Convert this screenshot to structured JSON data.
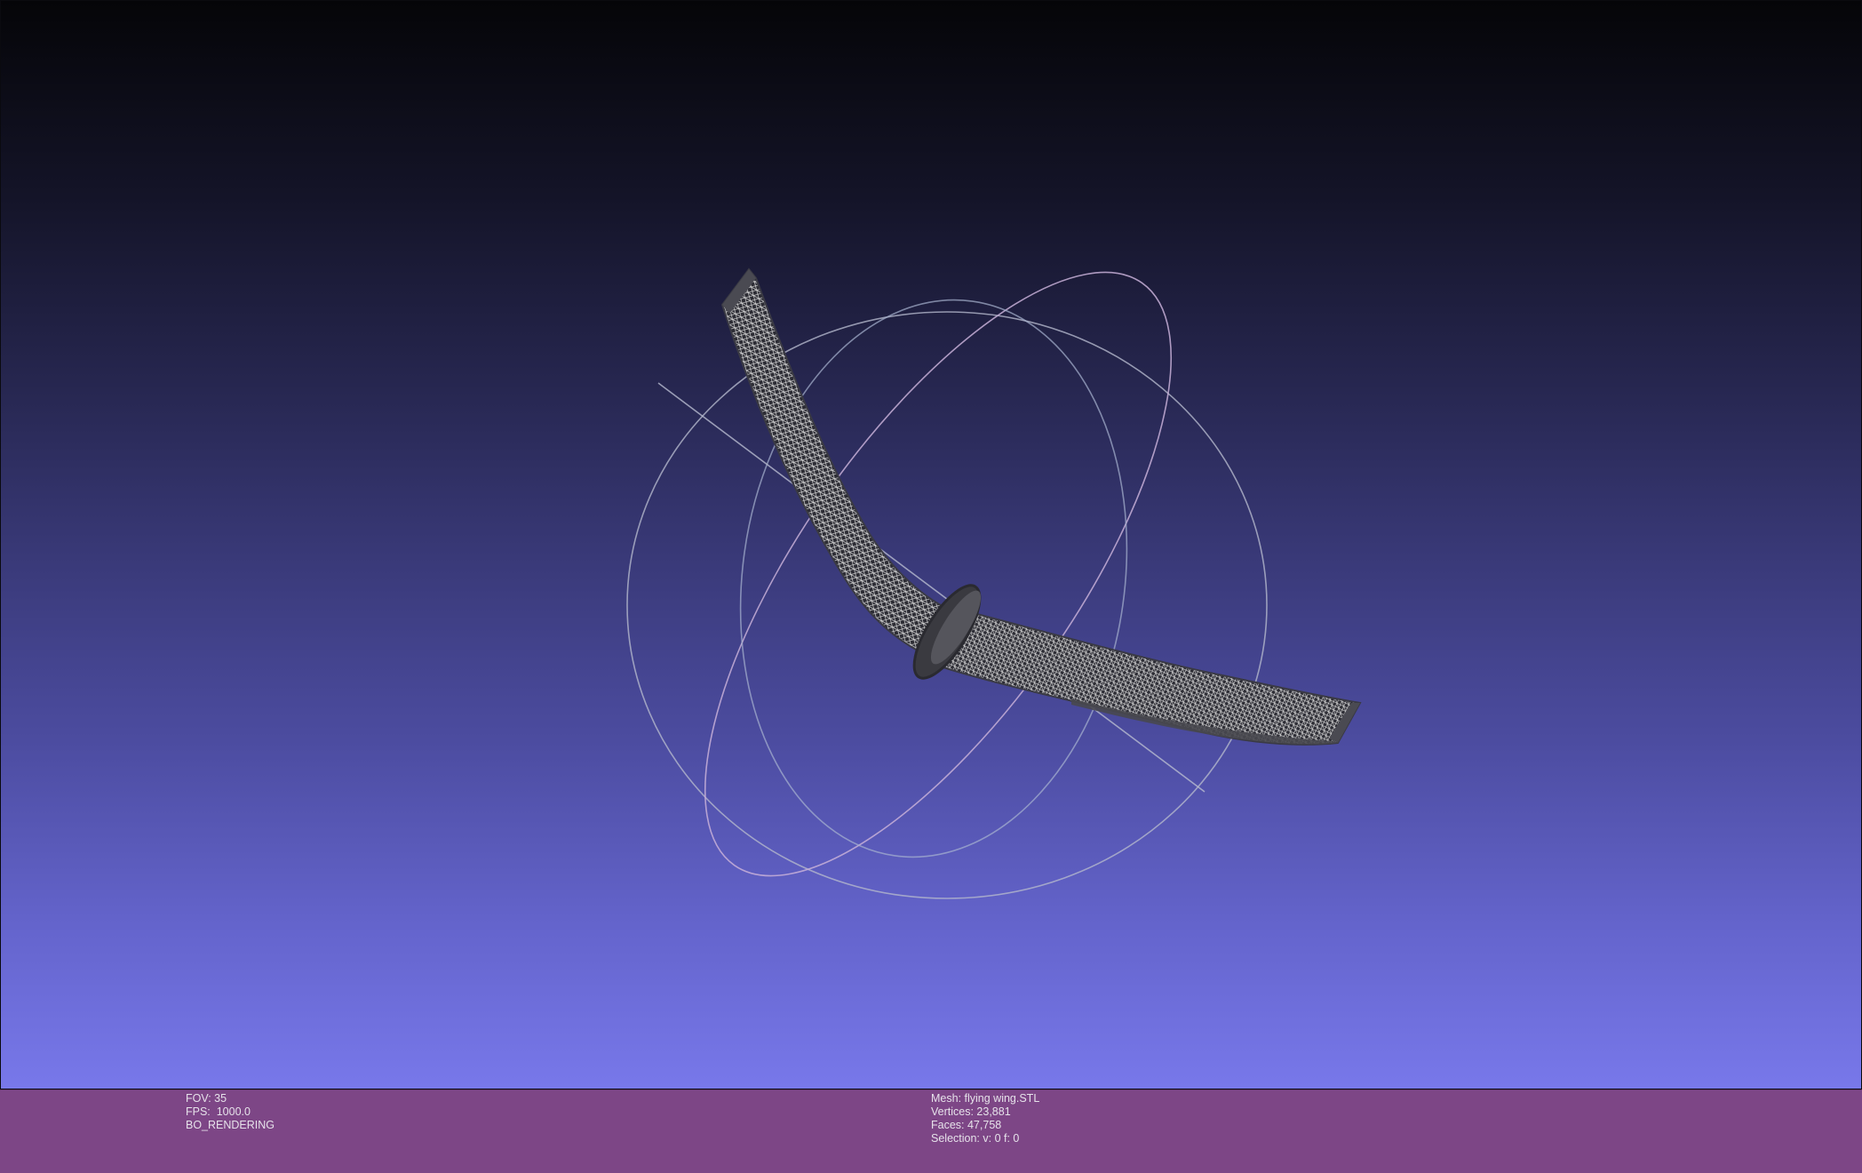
{
  "viewer": {
    "background_top_color": "#050508",
    "background_bottom_color": "#7878ea",
    "mesh_color": "#d8d8d8",
    "trackball_colors": [
      "#c8b0d8",
      "#a8b4d0",
      "#b8b8c8"
    ]
  },
  "info_left": {
    "fov": "FOV: 35",
    "fps": "FPS:  1000.0",
    "render_mode": "BO_RENDERING"
  },
  "info_right": {
    "mesh": "Mesh: flying wing.STL",
    "vertices": "Vertices: 23,881",
    "faces": "Faces: 47,758",
    "selection": "Selection: v: 0 f: 0"
  },
  "info_bar_color": "#7d4686"
}
